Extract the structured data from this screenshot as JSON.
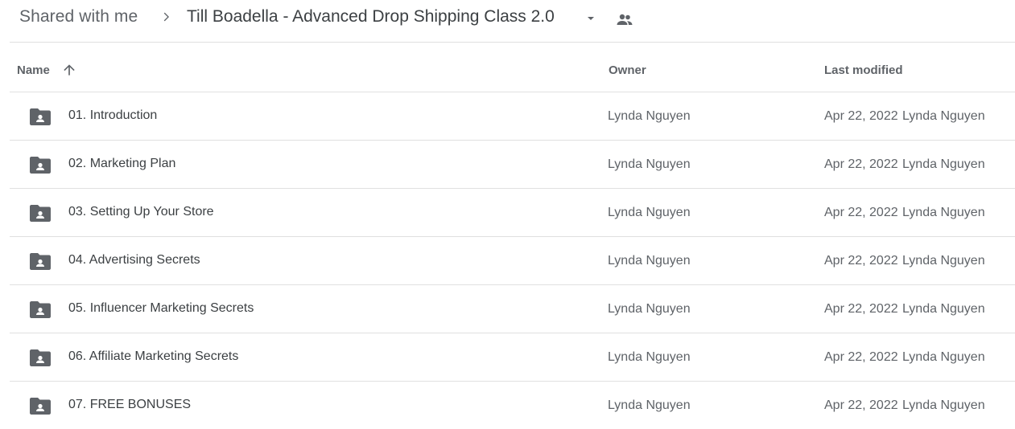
{
  "breadcrumb": {
    "root": "Shared with me",
    "current": "Till Boadella - Advanced Drop Shipping Class 2.0",
    "separator_icon": "chevron-right-icon",
    "caret_icon": "caret-down-icon",
    "shared_icon": "people-icon"
  },
  "columns": {
    "name": "Name",
    "owner": "Owner",
    "last_modified": "Last modified",
    "sort_icon": "arrow-up-icon"
  },
  "files": [
    {
      "name": "01. Introduction",
      "owner": "Lynda Nguyen",
      "modified_date": "Apr 22, 2022",
      "modified_by": "Lynda Nguyen",
      "icon": "shared-folder-icon"
    },
    {
      "name": "02. Marketing Plan",
      "owner": "Lynda Nguyen",
      "modified_date": "Apr 22, 2022",
      "modified_by": "Lynda Nguyen",
      "icon": "shared-folder-icon"
    },
    {
      "name": "03. Setting Up Your Store",
      "owner": "Lynda Nguyen",
      "modified_date": "Apr 22, 2022",
      "modified_by": "Lynda Nguyen",
      "icon": "shared-folder-icon"
    },
    {
      "name": "04. Advertising Secrets",
      "owner": "Lynda Nguyen",
      "modified_date": "Apr 22, 2022",
      "modified_by": "Lynda Nguyen",
      "icon": "shared-folder-icon"
    },
    {
      "name": "05. Influencer Marketing Secrets",
      "owner": "Lynda Nguyen",
      "modified_date": "Apr 22, 2022",
      "modified_by": "Lynda Nguyen",
      "icon": "shared-folder-icon"
    },
    {
      "name": "06. Affiliate Marketing Secrets",
      "owner": "Lynda Nguyen",
      "modified_date": "Apr 22, 2022",
      "modified_by": "Lynda Nguyen",
      "icon": "shared-folder-icon"
    },
    {
      "name": "07. FREE BONUSES",
      "owner": "Lynda Nguyen",
      "modified_date": "Apr 22, 2022",
      "modified_by": "Lynda Nguyen",
      "icon": "shared-folder-icon"
    }
  ],
  "colors": {
    "text_primary": "#3c4043",
    "text_secondary": "#5f6368",
    "divider": "#e0e0e0",
    "icon": "#5f6368"
  }
}
